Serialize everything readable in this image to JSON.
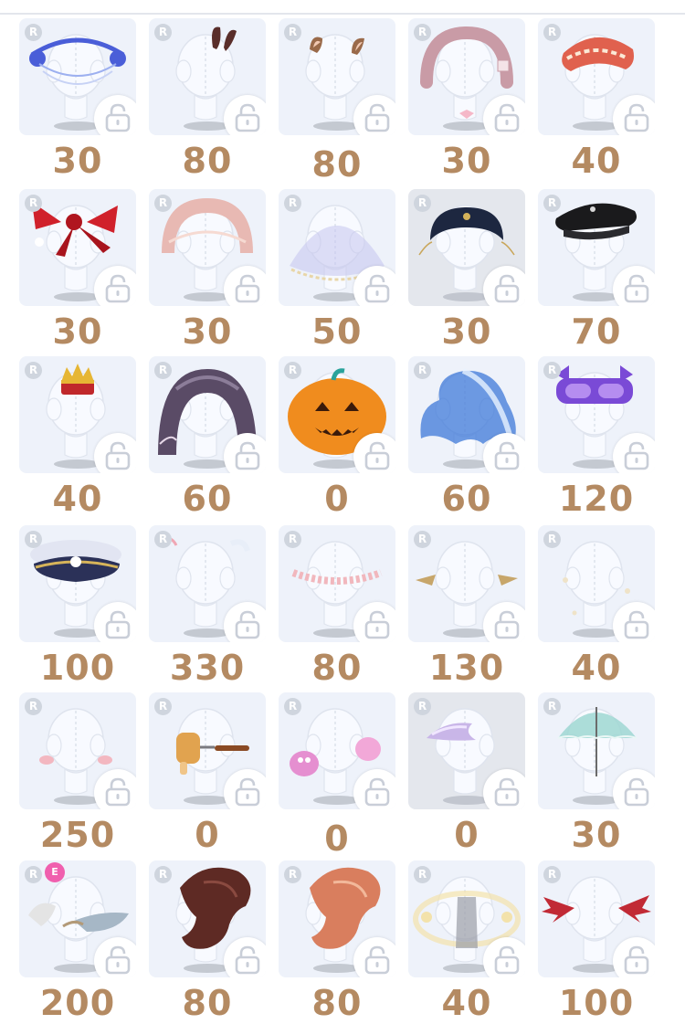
{
  "rarity_badge": "R",
  "extra_badge": "E",
  "items": [
    {
      "price": "30",
      "accessory": "blue-flower-garland",
      "icon": "flower-icon",
      "color": "#4a5ed8"
    },
    {
      "price": "80",
      "accessory": "dark-bunny-ears",
      "icon": "ears-icon",
      "color": "#5a2e2a"
    },
    {
      "price": "80",
      "accessory": "brown-animal-ears",
      "icon": "ears-icon",
      "color": "#9a6a4a"
    },
    {
      "price": "30",
      "accessory": "pink-frame-headband",
      "icon": "headband-icon",
      "color": "#c99ba6"
    },
    {
      "price": "40",
      "accessory": "red-white-bonnet",
      "icon": "bonnet-icon",
      "color": "#e0614e"
    },
    {
      "price": "30",
      "accessory": "red-bow",
      "icon": "bow-icon",
      "color": "#d0212b"
    },
    {
      "price": "30",
      "accessory": "pink-halo-headband",
      "icon": "halo-icon",
      "color": "#e8b9b3"
    },
    {
      "price": "50",
      "accessory": "lavender-lace-veil",
      "icon": "veil-icon",
      "color": "#c5c4ee"
    },
    {
      "price": "30",
      "accessory": "black-gold-headpiece",
      "icon": "headpiece-icon",
      "color": "#1d2740"
    },
    {
      "price": "70",
      "accessory": "black-beret",
      "icon": "hat-icon",
      "color": "#1a1a1c"
    },
    {
      "price": "40",
      "accessory": "mini-crown",
      "icon": "crown-icon",
      "color": "#c0282b"
    },
    {
      "price": "60",
      "accessory": "dark-lace-hood",
      "icon": "hood-icon",
      "color": "#5a4b66"
    },
    {
      "price": "0",
      "accessory": "pumpkin-head",
      "icon": "pumpkin-icon",
      "color": "#f08c1e"
    },
    {
      "price": "60",
      "accessory": "blue-wave-hair",
      "icon": "hair-icon",
      "color": "#3d78d8"
    },
    {
      "price": "120",
      "accessory": "purple-cat-goggles",
      "icon": "goggles-icon",
      "color": "#7a4ad6"
    },
    {
      "price": "100",
      "accessory": "navy-captain-hat",
      "icon": "hat-icon",
      "color": "#2b3158"
    },
    {
      "price": "330",
      "accessory": "white-ribbons",
      "icon": "ribbon-icon",
      "color": "#e8eef8"
    },
    {
      "price": "80",
      "accessory": "pink-blush-wreath",
      "icon": "wreath-icon",
      "color": "#f1b7bd"
    },
    {
      "price": "130",
      "accessory": "gold-elf-ears",
      "icon": "ears-icon",
      "color": "#c7a66a"
    },
    {
      "price": "40",
      "accessory": "pale-sparkle-garland",
      "icon": "sparkle-icon",
      "color": "#efe3c8"
    },
    {
      "price": "250",
      "accessory": "pink-cheek-blush",
      "icon": "blush-icon",
      "color": "#f4a8b2"
    },
    {
      "price": "0",
      "accessory": "toy-hammer",
      "icon": "hammer-icon",
      "color": "#e1a34f"
    },
    {
      "price": "0",
      "accessory": "pink-paw-earmuffs",
      "icon": "paw-icon",
      "color": "#e58fd0"
    },
    {
      "price": "0",
      "accessory": "small-white-wings",
      "icon": "wing-icon",
      "color": "#c9b6e8"
    },
    {
      "price": "30",
      "accessory": "mint-parasol",
      "icon": "umbrella-icon",
      "color": "#9fd7d2"
    },
    {
      "price": "200",
      "accessory": "cat-ears-with-tail",
      "icon": "ears-icon",
      "color": "#a6b7c6",
      "extra": true
    },
    {
      "price": "80",
      "accessory": "brown-side-hair",
      "icon": "hair-icon",
      "color": "#5e2a24"
    },
    {
      "price": "80",
      "accessory": "peach-side-hair",
      "icon": "hair-icon",
      "color": "#d97e5e"
    },
    {
      "price": "40",
      "accessory": "glow-orbs-aura",
      "icon": "aura-icon",
      "color": "#f3e2ab"
    },
    {
      "price": "100",
      "accessory": "red-bat-wings",
      "icon": "wing-icon",
      "color": "#c12a35"
    }
  ]
}
